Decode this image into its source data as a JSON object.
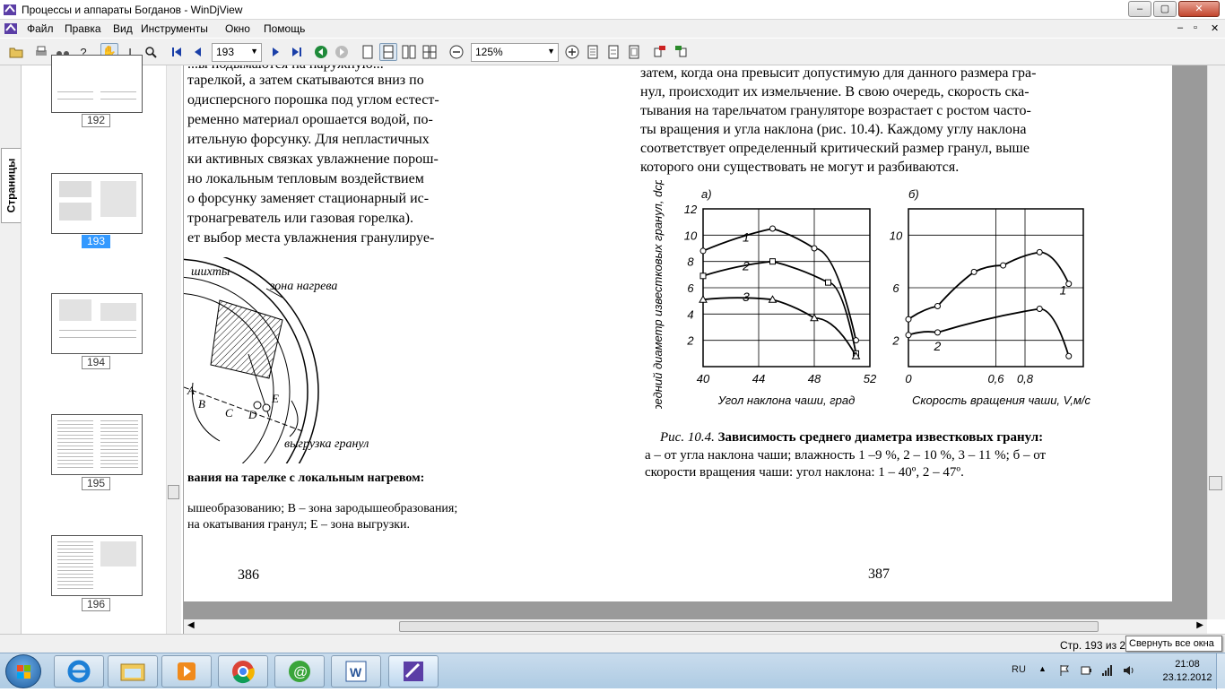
{
  "window": {
    "title": "Процессы и аппараты Богданов - WinDjView",
    "min": "–",
    "max": "▢",
    "close": "✕"
  },
  "menu": {
    "items": [
      {
        "label": "Файл"
      },
      {
        "label": "Правка"
      },
      {
        "label": "Вид"
      },
      {
        "label": "Инструменты"
      },
      {
        "label": "Окно"
      },
      {
        "label": "Помощь"
      }
    ]
  },
  "toolbar": {
    "page_value": "193",
    "zoom_value": "125%"
  },
  "side_tab": {
    "label": "Страницы"
  },
  "pages_panel": {
    "thumbnails": [
      {
        "label": "192"
      },
      {
        "label": "193",
        "selected": true
      },
      {
        "label": "194"
      },
      {
        "label": "195"
      },
      {
        "label": "196"
      }
    ]
  },
  "document": {
    "left_page": {
      "lines": [
        "...ы подымаются на наружную...",
        "тарелкой, а затем скатываются вниз по",
        "одисперсного порошка под углом естест-",
        "ременно материал орошается водой, по-",
        "ительную форсунку. Для непластичных",
        "ки активных связках увлажнение порош-",
        "но локальным тепловым воздействием",
        "о форсунку заменяет стационарный ис-",
        "тронагреватель или газовая горелка).",
        "ет выбор места увлажнения гранулируе-"
      ],
      "fig_labels": {
        "charge": "шихты",
        "heat_zone": "зона нагрева",
        "unload": "выгрузка гранул",
        "A": "A",
        "B": "B",
        "C": "C",
        "D": "D",
        "E": "E"
      },
      "caption_title": "вания на тарелке с локальным нагревом:",
      "caption_line2": "ышеобразованию; B – зона зародышеобразования;",
      "caption_line3": "на окатывания гранул; E – зона выгрузки.",
      "page_number": "386"
    },
    "right_page": {
      "lines": [
        "затем, когда она превысит допустимую для данного размера гра-",
        "нул, происходит их измельчение. В свою очередь, скорость ска-",
        "тывания на тарельчатом грануляторе возрастает с ростом часто-",
        "ты вращения и угла наклона (рис. 10.4). Каждому углу наклона",
        "соответствует определенный критический размер гранул, выше",
        "которого они существовать не могут и разбиваются."
      ],
      "caption_prefix": "Рис. 10.4. ",
      "caption_bold": "Зависимость среднего диаметра известковых гранул:",
      "caption_line2": "а – от угла наклона чаши; влажность 1 –9 %, 2 – 10 %, 3 – 11 %; б – от",
      "caption_line3": "скорости вращения чаши: угол наклона: 1 – 40º, 2 – 47º.",
      "page_number": "387"
    }
  },
  "status": {
    "page": "Стр. 193 из 25",
    "tooltip": "Свернуть все окна"
  },
  "tray": {
    "lang": "RU",
    "time": "21:08",
    "date": "23.12.2012"
  },
  "chart_data": [
    {
      "type": "line",
      "title": "а)",
      "xlabel": "Угол наклона чаши, град",
      "ylabel": "Средний диаметр известковых гранул, dср, мм",
      "xlim": [
        40,
        52
      ],
      "ylim": [
        0,
        12
      ],
      "xticks": [
        "40",
        "44",
        "48",
        "52"
      ],
      "yticks": [
        "2",
        "4",
        "6",
        "8",
        "10",
        "12"
      ],
      "series": [
        {
          "name": "1",
          "x": [
            40,
            45,
            48,
            51
          ],
          "y": [
            8.8,
            10.5,
            9.0,
            2.0
          ]
        },
        {
          "name": "2",
          "x": [
            40,
            45,
            49,
            51
          ],
          "y": [
            6.9,
            8.0,
            6.4,
            1.0
          ]
        },
        {
          "name": "3",
          "x": [
            40,
            45,
            48,
            51
          ],
          "y": [
            5.1,
            5.1,
            3.7,
            0.8
          ]
        }
      ]
    },
    {
      "type": "line",
      "title": "б)",
      "xlabel": "Скорость вращения чаши, V,м/с",
      "ylabel": "",
      "xlim": [
        0,
        1.2
      ],
      "ylim": [
        0,
        12
      ],
      "xticks": [
        "0",
        "0,6",
        "0,8"
      ],
      "yticks": [
        "2",
        "6",
        "10"
      ],
      "series": [
        {
          "name": "1",
          "x": [
            0,
            0.2,
            0.45,
            0.65,
            0.9,
            1.1
          ],
          "y": [
            3.6,
            4.6,
            7.2,
            7.7,
            8.7,
            6.3
          ]
        },
        {
          "name": "2",
          "x": [
            0,
            0.2,
            0.9,
            1.1
          ],
          "y": [
            2.4,
            2.6,
            4.4,
            0.8
          ]
        }
      ]
    }
  ]
}
